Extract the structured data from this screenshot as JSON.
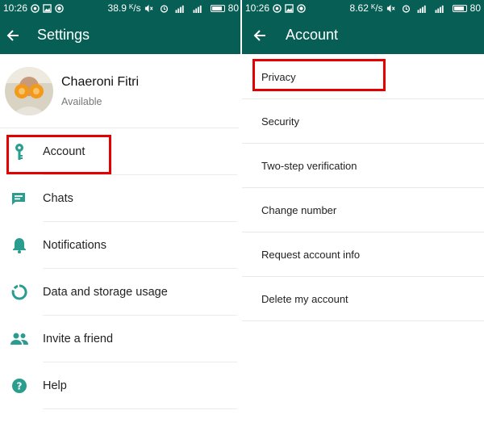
{
  "colors": {
    "header": "#075e54",
    "accent": "#2a9d8f",
    "highlight": "#e30000"
  },
  "left": {
    "status": {
      "time": "10:26",
      "battery_text": "38.9 ᴷ/s",
      "battery_level": "80"
    },
    "header": {
      "title": "Settings",
      "back_icon": "arrow-left-icon"
    },
    "profile": {
      "name": "Chaeroni Fitri",
      "status": "Available"
    },
    "items": [
      {
        "label": "Account",
        "icon": "key-icon"
      },
      {
        "label": "Chats",
        "icon": "chat-icon"
      },
      {
        "label": "Notifications",
        "icon": "bell-icon"
      },
      {
        "label": "Data and storage usage",
        "icon": "data-usage-icon"
      },
      {
        "label": "Invite a friend",
        "icon": "people-icon"
      },
      {
        "label": "Help",
        "icon": "help-icon"
      }
    ]
  },
  "right": {
    "status": {
      "time": "10:26",
      "speed_text": "8.62 ᴷ/s",
      "battery_level": "80"
    },
    "header": {
      "title": "Account",
      "back_icon": "arrow-left-icon"
    },
    "items": [
      {
        "label": "Privacy"
      },
      {
        "label": "Security"
      },
      {
        "label": "Two-step verification"
      },
      {
        "label": "Change number"
      },
      {
        "label": "Request account info"
      },
      {
        "label": "Delete my account"
      }
    ]
  }
}
